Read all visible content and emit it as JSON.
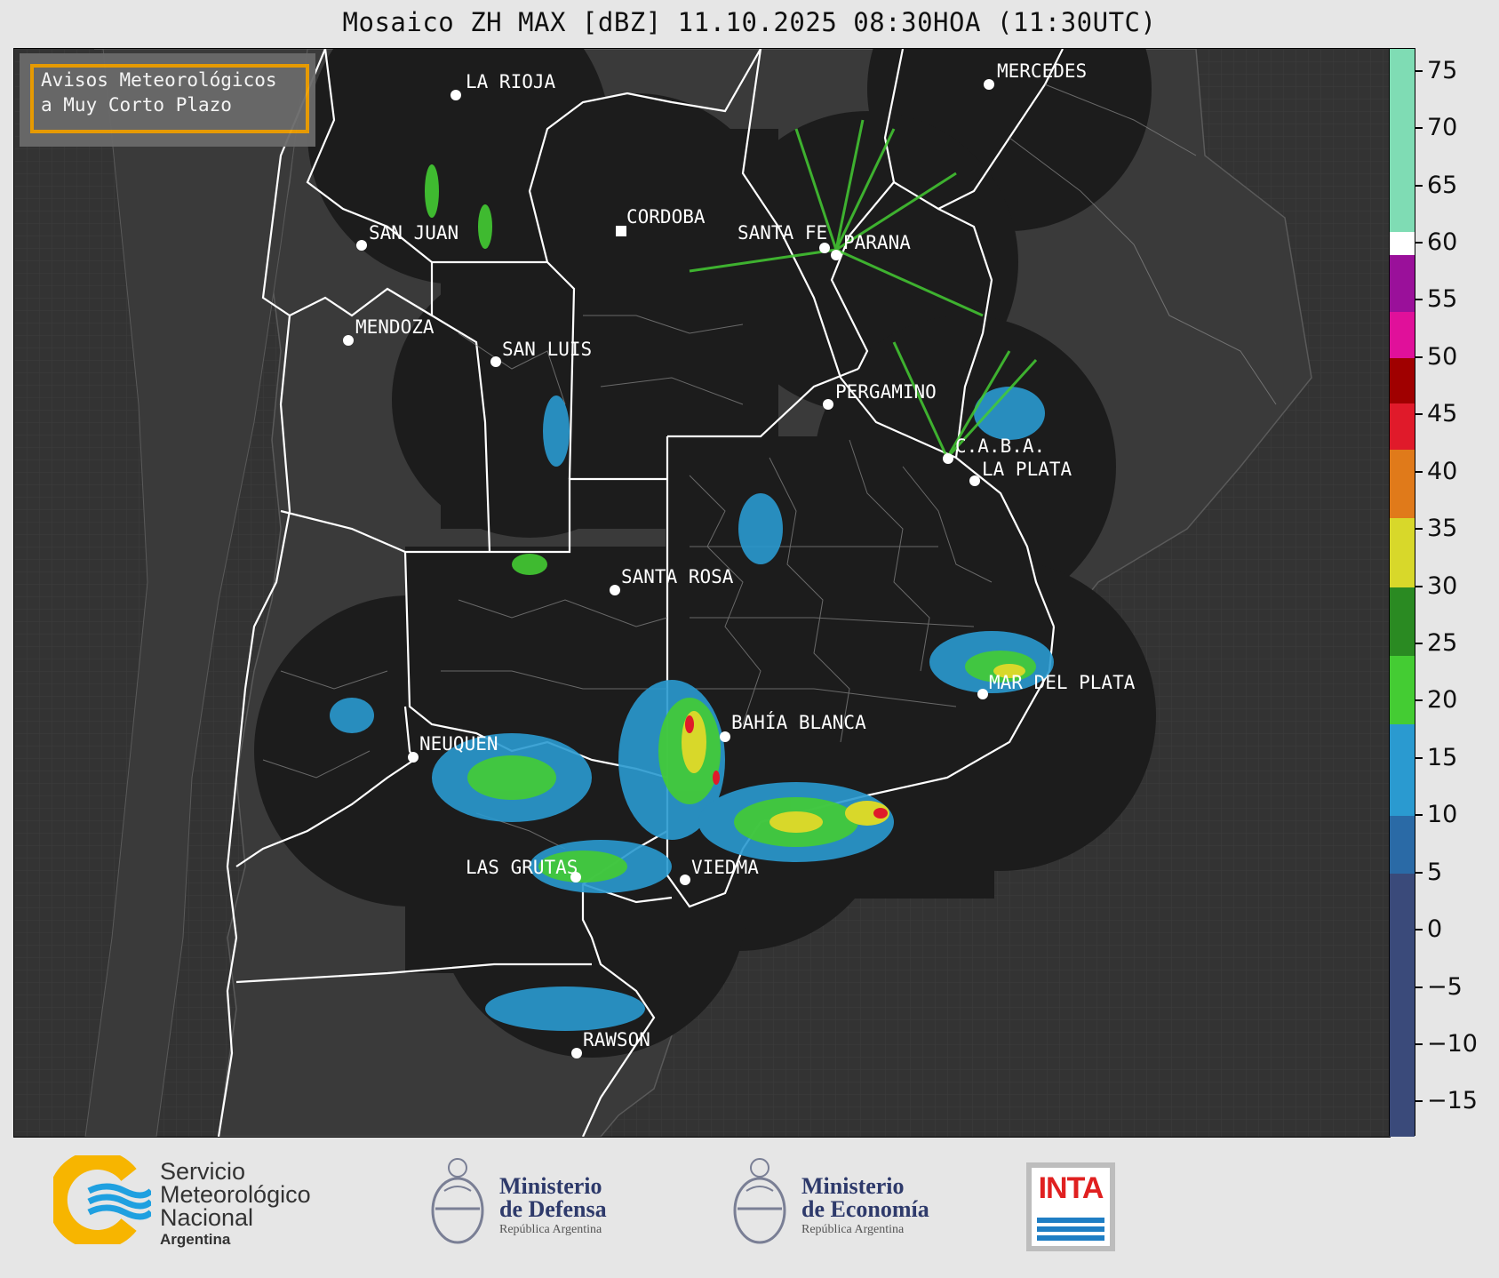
{
  "title": "Mosaico ZH MAX [dBZ] 11.10.2025 08:30HOA (11:30UTC)",
  "avisos": {
    "line1": "Avisos Meteorológicos",
    "line2": "a Muy Corto Plazo"
  },
  "colors": {
    "ocean": "#333333",
    "land": "#3a3a3a",
    "radar_coverage": "#1c1c1c",
    "border": "#ffffff",
    "avisos_border": "#f0a000"
  },
  "cities": [
    {
      "name": "LA RIOJA"
    },
    {
      "name": "MERCEDES"
    },
    {
      "name": "CORDOBA"
    },
    {
      "name": "SAN JUAN"
    },
    {
      "name": "SANTA FE"
    },
    {
      "name": "PARANA"
    },
    {
      "name": "MENDOZA"
    },
    {
      "name": "SAN LUIS"
    },
    {
      "name": "PERGAMINO"
    },
    {
      "name": "C.A.B.A."
    },
    {
      "name": "LA PLATA"
    },
    {
      "name": "SANTA ROSA"
    },
    {
      "name": "MAR DEL PLATA"
    },
    {
      "name": "BAHÍA BLANCA"
    },
    {
      "name": "NEUQUEN"
    },
    {
      "name": "LAS GRUTAS"
    },
    {
      "name": "VIEDMA"
    },
    {
      "name": "RAWSON"
    }
  ],
  "colorbar": {
    "unit": "dBZ",
    "min": -18,
    "max": 77,
    "ticks": [
      "75",
      "70",
      "65",
      "60",
      "55",
      "50",
      "45",
      "40",
      "35",
      "30",
      "25",
      "20",
      "15",
      "10",
      "5",
      "0",
      "−5",
      "−10",
      "−15"
    ],
    "tick_values": [
      75,
      70,
      65,
      60,
      55,
      50,
      45,
      40,
      35,
      30,
      25,
      20,
      15,
      10,
      5,
      0,
      -5,
      -10,
      -15
    ],
    "stops": [
      {
        "from": -18,
        "to": 5,
        "color": "#3a4a7a"
      },
      {
        "from": 5,
        "to": 10,
        "color": "#2a6aa6"
      },
      {
        "from": 10,
        "to": 18,
        "color": "#2a9ad0"
      },
      {
        "from": 18,
        "to": 24,
        "color": "#44cc33"
      },
      {
        "from": 24,
        "to": 30,
        "color": "#2a8a22"
      },
      {
        "from": 30,
        "to": 36,
        "color": "#d8d82a"
      },
      {
        "from": 36,
        "to": 42,
        "color": "#e07a1a"
      },
      {
        "from": 42,
        "to": 46,
        "color": "#e01a2a"
      },
      {
        "from": 46,
        "to": 50,
        "color": "#a00000"
      },
      {
        "from": 50,
        "to": 54,
        "color": "#e0109a"
      },
      {
        "from": 54,
        "to": 59,
        "color": "#9a109a"
      },
      {
        "from": 59,
        "to": 61,
        "color": "#ffffff"
      },
      {
        "from": 61,
        "to": 77,
        "color": "#7fdcb4"
      }
    ]
  },
  "footer": {
    "smn": {
      "line1": "Servicio",
      "line2": "Meteorológico",
      "line3": "Nacional",
      "line4": "Argentina"
    },
    "defensa": {
      "line1": "Ministerio",
      "line2": "de Defensa",
      "line3": "República Argentina"
    },
    "economia": {
      "line1": "Ministerio",
      "line2": "de Economía",
      "line3": "República Argentina"
    },
    "inta": {
      "label": "INTA"
    }
  }
}
